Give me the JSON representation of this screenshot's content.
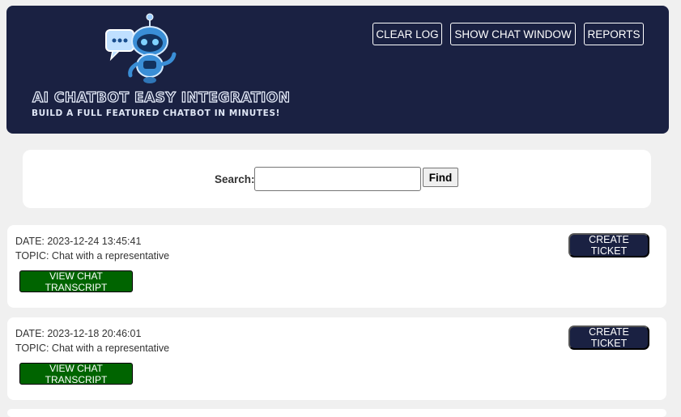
{
  "header": {
    "logo_title": "AI CHATBOT EASY INTEGRATION",
    "logo_subtitle": "BUILD A FULL FEATURED CHATBOT IN MINUTES!",
    "buttons": {
      "clear_log": "CLEAR LOG",
      "show_chat_window": "SHOW CHAT WINDOW",
      "reports": "REPORTS"
    }
  },
  "search": {
    "label": "Search:",
    "value": "",
    "placeholder": "",
    "find_label": "Find"
  },
  "entries": [
    {
      "date": "DATE: 2023-12-24 13:45:41",
      "topic": "TOPIC: Chat with a representative",
      "transcript_label": "VIEW CHAT TRANSCRIPT",
      "ticket_label": "CREATE TICKET"
    },
    {
      "date": "DATE: 2023-12-18 20:46:01",
      "topic": "TOPIC: Chat with a representative",
      "transcript_label": "VIEW CHAT TRANSCRIPT",
      "ticket_label": "CREATE TICKET"
    }
  ],
  "colors": {
    "header_bg": "#1a2142",
    "transcript_btn_bg": "#006400",
    "ticket_btn_bg": "#1a2142",
    "page_bg": "#f0f0f0"
  },
  "icons": {
    "logo": "robot-chatbot-logo-icon"
  }
}
